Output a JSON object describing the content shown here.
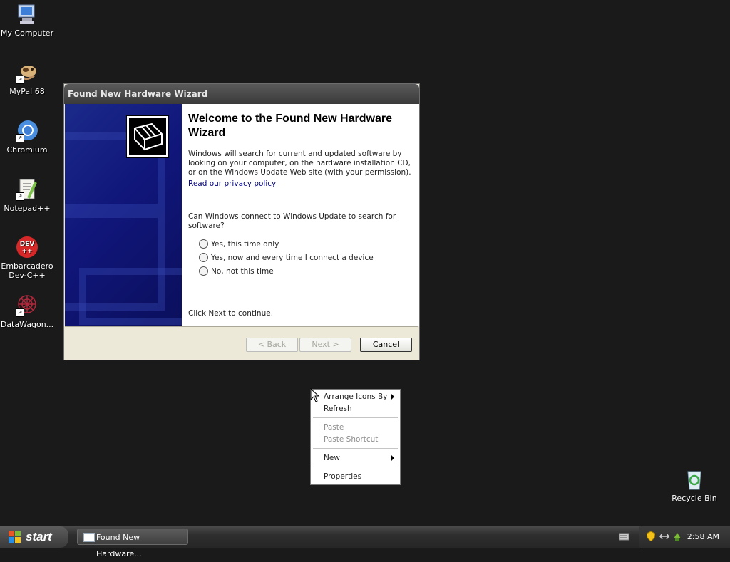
{
  "desktop": {
    "icons": [
      {
        "label": "My Computer",
        "icon": "computer-icon"
      },
      {
        "label": "MyPal 68",
        "icon": "mypal-icon"
      },
      {
        "label": "Chromium",
        "icon": "chromium-icon"
      },
      {
        "label": "Notepad++",
        "icon": "notepadpp-icon"
      },
      {
        "label": "Embarcadero Dev-C++",
        "icon": "devcpp-icon"
      },
      {
        "label": "DataWagon...",
        "icon": "datawagon-icon"
      }
    ],
    "recycle_bin": {
      "label": "Recycle Bin",
      "icon": "recycle-bin-icon"
    }
  },
  "wizard": {
    "title": "Found New Hardware Wizard",
    "heading": "Welcome to the Found New Hardware Wizard",
    "description": "Windows will search for current and updated software by looking on your computer, on the hardware installation CD, or on the Windows Update Web site (with your permission).",
    "privacy_link": "Read our privacy policy",
    "question": "Can Windows connect to Windows Update to search for software?",
    "options": [
      "Yes, this time only",
      "Yes, now and every time I connect a device",
      "No, not this time"
    ],
    "continue_text": "Click Next to continue.",
    "buttons": {
      "back": "< Back",
      "next": "Next >",
      "cancel": "Cancel"
    }
  },
  "context_menu": {
    "items": [
      {
        "label": "Arrange Icons By",
        "submenu": true,
        "enabled": true
      },
      {
        "label": "Refresh",
        "submenu": false,
        "enabled": true
      },
      {
        "label": "Paste",
        "submenu": false,
        "enabled": false
      },
      {
        "label": "Paste Shortcut",
        "submenu": false,
        "enabled": false
      },
      {
        "label": "New",
        "submenu": true,
        "enabled": true
      },
      {
        "label": "Properties",
        "submenu": false,
        "enabled": true
      }
    ]
  },
  "taskbar": {
    "start_label": "start",
    "task_button": "Found New Hardware...",
    "clock": "2:58 AM"
  },
  "colors": {
    "desktop": "#1a1a1a",
    "wizard_side": "#10167a",
    "link": "#000080"
  }
}
